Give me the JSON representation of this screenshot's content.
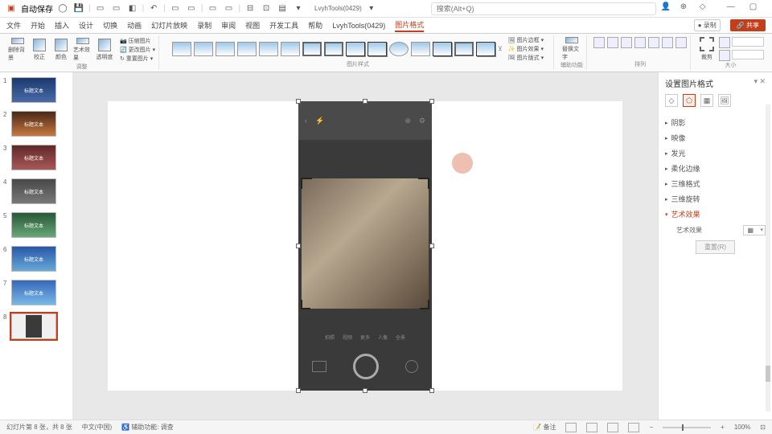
{
  "titlebar": {
    "autosave": "自动保存",
    "search_placeholder": "搜索(Alt+Q)",
    "addin": "LvyhTools(0429)"
  },
  "tabs": {
    "file": "文件",
    "home": "开始",
    "insert": "插入",
    "design": "设计",
    "transition": "切换",
    "animation": "动画",
    "slideshow": "幻灯片放映",
    "record": "录制",
    "review": "审阅",
    "view": "视图",
    "dev": "开发工具",
    "help": "帮助",
    "addin": "LvyhTools(0429)",
    "pic_format": "图片格式",
    "rec_btn": "● 录制",
    "share": "🔗 共享"
  },
  "ribbon": {
    "g1_btn1": "删除背景",
    "g1_btn2": "校正",
    "g1_btn3": "颜色",
    "g1_btn4": "艺术效果",
    "g1_btn5": "透明度",
    "g1_line1": "📷 压缩图片",
    "g1_line2": "🔄 更改图片 ▾",
    "g1_line3": "↻ 重置图片 ▾",
    "g1_label": "调整",
    "g2_label": "图片样式",
    "g2_line1": "🖼 图片边框 ▾",
    "g2_line2": "✨ 图片效果 ▾",
    "g2_line3": "🖼 图片版式 ▾",
    "g3_label": "辅助功能",
    "g3_btn": "替换文字",
    "g4_label": "排列",
    "g5_btn": "裁剪",
    "g5_label": "大小"
  },
  "slides": [
    {
      "num": "1",
      "cls": "t1",
      "txt": "标题文本"
    },
    {
      "num": "2",
      "cls": "t2",
      "txt": "标题文本"
    },
    {
      "num": "3",
      "cls": "t3",
      "txt": "标题文本"
    },
    {
      "num": "4",
      "cls": "t4",
      "txt": "标题文本"
    },
    {
      "num": "5",
      "cls": "t5",
      "txt": "标题文本"
    },
    {
      "num": "6",
      "cls": "t6",
      "txt": "标题文本"
    },
    {
      "num": "7",
      "cls": "t7",
      "txt": "标题文本"
    },
    {
      "num": "8",
      "cls": "t8",
      "txt": ""
    }
  ],
  "panel": {
    "title": "设置图片格式",
    "items": {
      "shadow": "阴影",
      "reflect": "映像",
      "glow": "发光",
      "soft": "柔化边缘",
      "threed": "三维格式",
      "rotate": "三维旋转",
      "art": "艺术效果"
    },
    "art_label": "艺术效果",
    "art_value": "▦",
    "reset": "重置(R)"
  },
  "status": {
    "slide_info": "幻灯片第 8 张，共 8 张",
    "lang": "中文(中国)",
    "access": "♿ 辅助功能: 调查",
    "notes": "📝 备注",
    "zoom": "100%"
  },
  "phone": {
    "m1": "拍照",
    "m2": "视频",
    "m3": "更多",
    "m4": "人像",
    "m5": "全景"
  }
}
